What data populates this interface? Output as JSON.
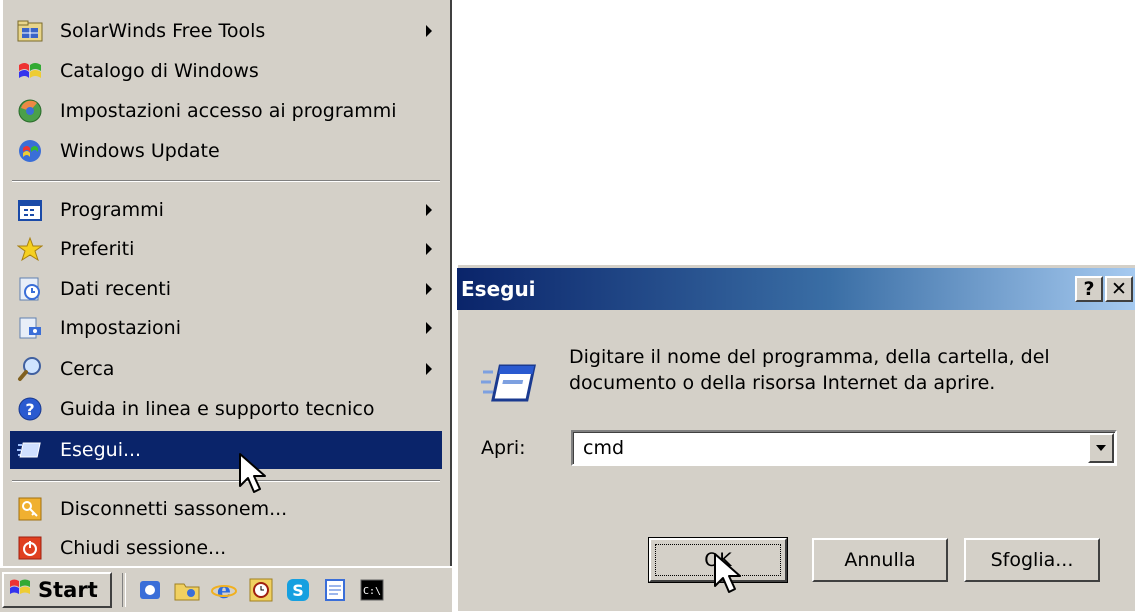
{
  "start_menu": {
    "top_items": [
      {
        "label": "SolarWinds Free Tools",
        "icon": "folder-grid-icon",
        "submenu": true
      },
      {
        "label": "Catalogo di Windows",
        "icon": "windows-catalog-icon",
        "submenu": false
      },
      {
        "label": "Impostazioni accesso ai programmi",
        "icon": "program-access-icon",
        "submenu": false
      },
      {
        "label": "Windows Update",
        "icon": "windows-update-icon",
        "submenu": false
      }
    ],
    "items": [
      {
        "label": "Programmi",
        "icon": "programs-icon",
        "submenu": true
      },
      {
        "label": "Preferiti",
        "icon": "favorites-star-icon",
        "submenu": true
      },
      {
        "label": "Dati recenti",
        "icon": "recent-documents-icon",
        "submenu": true
      },
      {
        "label": "Impostazioni",
        "icon": "settings-icon",
        "submenu": true
      },
      {
        "label": "Cerca",
        "icon": "search-icon",
        "submenu": true
      },
      {
        "label": "Guida in linea e supporto tecnico",
        "icon": "help-icon",
        "submenu": false
      },
      {
        "label": "Esegui...",
        "icon": "run-icon",
        "submenu": false,
        "selected": true
      }
    ],
    "bottom_items": [
      {
        "label": "Disconnetti sassonem...",
        "icon": "logoff-key-icon"
      },
      {
        "label": "Chiudi sessione...",
        "icon": "shutdown-icon"
      }
    ]
  },
  "taskbar": {
    "start_label": "Start",
    "quick_launch": [
      "explorer-icon",
      "folder-icon",
      "internet-explorer-icon",
      "clock-icon",
      "skype-icon",
      "notepad-icon",
      "command-prompt-icon"
    ]
  },
  "run_dialog": {
    "title": "Esegui",
    "help_button": "?",
    "close_button": "✕",
    "description": "Digitare il nome del programma, della cartella, del documento o della risorsa Internet da aprire.",
    "open_label": "Apri:",
    "open_value": "cmd",
    "ok_label": "OK",
    "cancel_label": "Annulla",
    "browse_label": "Sfoglia..."
  },
  "colors": {
    "face": "#d4d0c8",
    "selection": "#0a246a",
    "title_gradient_start": "#0a246a",
    "title_gradient_end": "#a6caf0"
  }
}
